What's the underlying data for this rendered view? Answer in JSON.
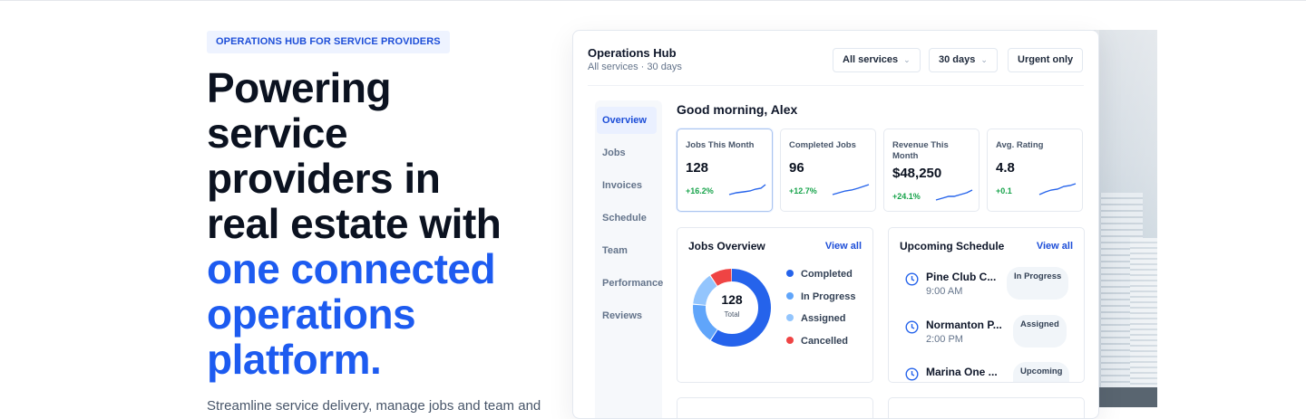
{
  "hero": {
    "badge": "OPERATIONS HUB FOR SERVICE PROVIDERS",
    "headline_lines": [
      "Powering",
      "service",
      "providers in",
      "real estate with"
    ],
    "headline_accent_lines": [
      "one connected",
      "operations",
      "platform."
    ],
    "subtext": "Streamline service delivery, manage jobs and team and"
  },
  "dashboard": {
    "title": "Operations Hub",
    "subtitle": "All services · 30 days",
    "filters": {
      "services": "All services",
      "period": "30 days",
      "urgent": "Urgent only"
    },
    "nav": [
      "Overview",
      "Jobs",
      "Invoices",
      "Schedule",
      "Team",
      "Performance",
      "Reviews"
    ],
    "active_nav": "Overview",
    "greeting": "Good morning, Alex",
    "stats": [
      {
        "label": "Jobs This Month",
        "value": "128",
        "change": "+16.2%"
      },
      {
        "label": "Completed Jobs",
        "value": "96",
        "change": "+12.7%"
      },
      {
        "label": "Revenue This Month",
        "value": "$48,250",
        "change": "+24.1%"
      },
      {
        "label": "Avg. Rating",
        "value": "4.8",
        "change": "+0.1"
      }
    ],
    "jobs_overview": {
      "title": "Jobs Overview",
      "view_all": "View all",
      "total": "128",
      "total_label": "Total",
      "legend": [
        {
          "label": "Completed",
          "value": "76",
          "color": "#2563eb"
        },
        {
          "label": "In Progress",
          "value": "22",
          "color": "#60a5fa"
        },
        {
          "label": "Assigned",
          "value": "18",
          "color": "#93c5fd"
        },
        {
          "label": "Cancelled",
          "value": "12",
          "color": "#ef4444"
        }
      ]
    },
    "schedule": {
      "title": "Upcoming Schedule",
      "view_all": "View all",
      "items": [
        {
          "name": "Pine Club C...",
          "time": "9:00 AM",
          "status": "In Progress"
        },
        {
          "name": "Normanton P...",
          "time": "2:00 PM",
          "status": "Assigned"
        },
        {
          "name": "Marina One ...",
          "time": "",
          "status": "Upcoming"
        }
      ]
    }
  }
}
